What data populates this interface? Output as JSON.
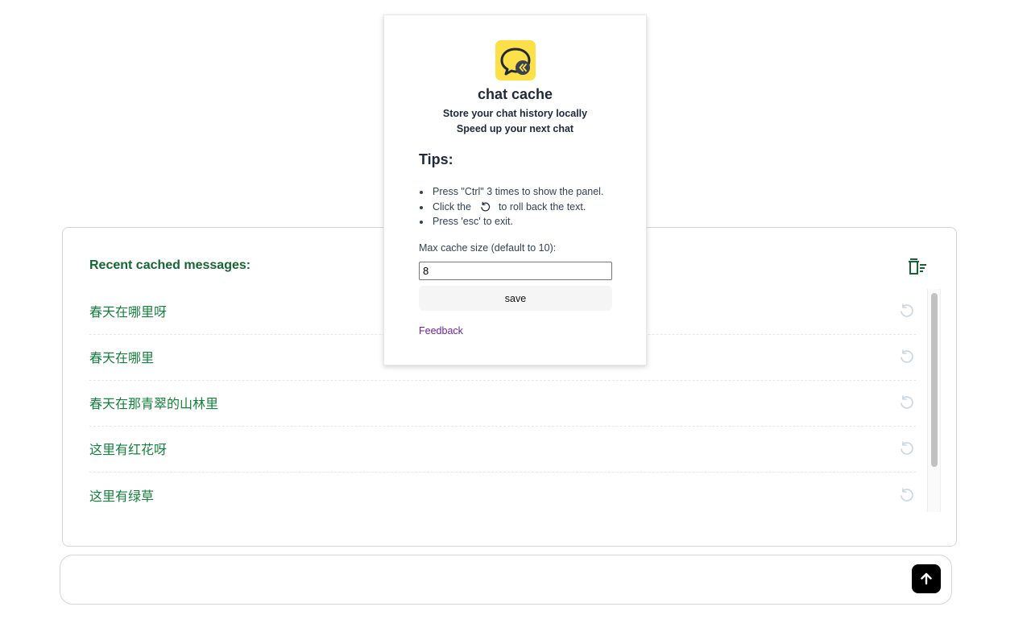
{
  "popup": {
    "app_name": "chat cache",
    "tagline_line1": "Store your chat history locally",
    "tagline_line2": "Speed up your next chat",
    "tips_title": "Tips:",
    "tips": {
      "tip1": "Press \"Ctrl\" 3 times to show the panel.",
      "tip2_before": "Click the",
      "tip2_after": "to roll back the text.",
      "tip3": "Press 'esc' to exit."
    },
    "size_label": "Max cache size (default to 10):",
    "size_value": "8",
    "save_label": "save",
    "feedback_label": "Feedback",
    "logo_color": "#fde047",
    "link_color": "#6b21a8",
    "icons": {
      "logo": "chat-bubble-rewind-icon",
      "tip_inline": "rollback-icon"
    }
  },
  "cache_panel": {
    "title": "Recent cached messages:",
    "accent_color": "#166534",
    "clear_icon": "trash-list-icon",
    "item_icon": "rollback-icon",
    "items": [
      "春天在哪里呀",
      "春天在哪里",
      "春天在那青翠的山林里",
      "这里有红花呀",
      "这里有绿草"
    ]
  },
  "chat_bar": {
    "placeholder": "",
    "send_icon": "arrow-up-icon"
  }
}
